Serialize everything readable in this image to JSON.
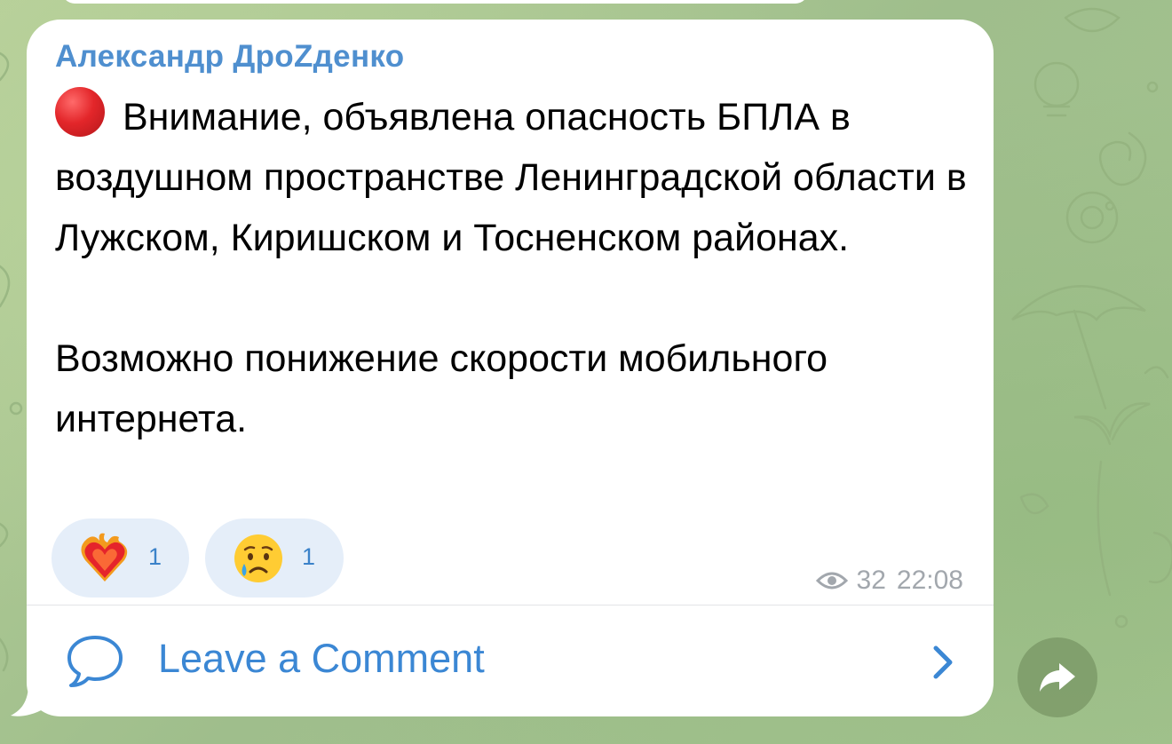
{
  "message": {
    "author": "Александр ДроZденко",
    "alert_icon": "red-circle-icon",
    "paragraphs": [
      "Внимание, объявлена опасность БПЛА в воздушном пространстве Ленинградской области в Лужском, Киришском и Тосненском районах.",
      "Возможно понижение скорости мобильного интернета."
    ],
    "reactions": [
      {
        "icon": "heart-on-fire-icon",
        "count": "1"
      },
      {
        "icon": "crying-face-icon",
        "count": "1"
      }
    ],
    "views": "32",
    "time": "22:08"
  },
  "comments": {
    "label": "Leave a Comment",
    "icon": "comment-bubble-icon"
  },
  "share_icon": "share-forward-icon",
  "colors": {
    "accent": "#3b87d4",
    "author": "#4f8fcf",
    "reaction_bg": "#e5eef9",
    "bubble_bg": "#ffffff",
    "chat_bg": "#a9c592"
  }
}
